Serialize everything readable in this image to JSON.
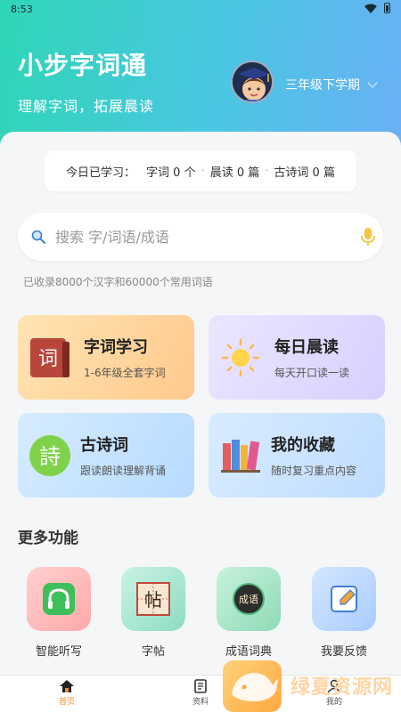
{
  "status_bar": {
    "time": "8:53"
  },
  "header": {
    "title": "小步字词通",
    "subtitle": "理解字词，拓展晨读",
    "grade": "三年级下学期"
  },
  "today": {
    "label": "今日已学习：",
    "stats": [
      "字词 0 个",
      "晨读 0 篇",
      "古诗词 0 篇"
    ]
  },
  "search": {
    "placeholder": "搜索 字/词语/成语",
    "hint": "已收录8000个汉字和60000个常用词语"
  },
  "cards": [
    {
      "title": "字词学习",
      "subtitle": "1-6年级全套字词",
      "icon": "book-ci-icon"
    },
    {
      "title": "每日晨读",
      "subtitle": "每天开口读一读",
      "icon": "sun-icon"
    },
    {
      "title": "古诗词",
      "subtitle": "跟读朗读理解背诵",
      "icon": "poem-icon"
    },
    {
      "title": "我的收藏",
      "subtitle": "随时复习重点内容",
      "icon": "books-icon"
    }
  ],
  "more": {
    "title": "更多功能",
    "items": [
      {
        "label": "智能听写",
        "icon": "headphones-icon"
      },
      {
        "label": "字帖",
        "icon": "copybook-icon"
      },
      {
        "label": "成语词典",
        "icon": "idiom-icon"
      },
      {
        "label": "我要反馈",
        "icon": "edit-icon"
      }
    ]
  },
  "tabs": [
    {
      "label": "首页",
      "icon": "home-icon",
      "active": true
    },
    {
      "label": "资料",
      "icon": "document-icon",
      "active": false
    },
    {
      "label": "我的",
      "icon": "user-icon",
      "active": false
    }
  ],
  "glyphs": {
    "ci": "词",
    "poem": "詩",
    "copybook": "帖",
    "idiom": "成语"
  },
  "watermark": {
    "text": "绿夏资源网"
  },
  "colors": {
    "accent": "#f28a2e",
    "header_start": "#2fd6b6",
    "header_end": "#6ab0f5"
  }
}
